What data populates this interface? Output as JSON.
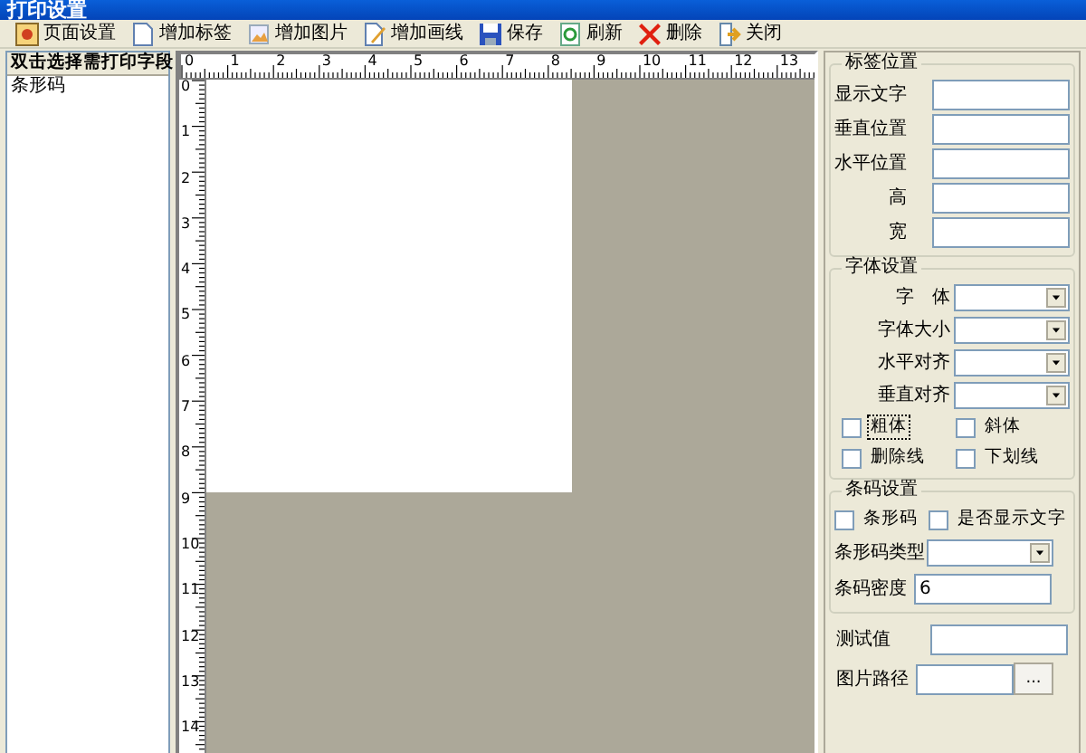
{
  "window": {
    "title": "打印设置"
  },
  "toolbar": [
    {
      "kind": "page",
      "label": "页面设置"
    },
    {
      "kind": "doc",
      "label": "增加标签"
    },
    {
      "kind": "image",
      "label": "增加图片"
    },
    {
      "kind": "pen",
      "label": "增加画线"
    },
    {
      "kind": "save",
      "label": "保存"
    },
    {
      "kind": "refresh",
      "label": "刷新"
    },
    {
      "kind": "delete",
      "label": "删除"
    },
    {
      "kind": "close",
      "label": "关闭"
    }
  ],
  "field_list": {
    "header": "双击选择需打印字段",
    "items": [
      {
        "label": "条形码",
        "selected": false
      }
    ]
  },
  "ruler": {
    "horizontal": [
      "0",
      "1",
      "2",
      "3",
      "4",
      "5",
      "6",
      "7",
      "8",
      "9",
      "10",
      "11",
      "12",
      "13"
    ],
    "vertical": [
      "0",
      "1",
      "2",
      "3",
      "4",
      "5",
      "6",
      "7",
      "8",
      "9",
      "10",
      "11",
      "12",
      "13",
      "14"
    ]
  },
  "label_position": {
    "title": "标签位置",
    "fields": [
      {
        "label": "显示文字"
      },
      {
        "label": "垂直位置"
      },
      {
        "label": "水平位置"
      },
      {
        "label": "高"
      },
      {
        "label": "宽"
      }
    ]
  },
  "font_settings": {
    "title": "字体设置",
    "selects": [
      {
        "label": "字　体"
      },
      {
        "label": "字体大小"
      },
      {
        "label": "水平对齐"
      },
      {
        "label": "垂直对齐"
      }
    ],
    "checkboxes": [
      {
        "label": "粗体",
        "checked": false,
        "focused": true
      },
      {
        "label": "斜体",
        "checked": false,
        "focused": false
      },
      {
        "label": "删除线",
        "checked": false,
        "focused": false
      },
      {
        "label": "下划线",
        "checked": false,
        "focused": false
      }
    ]
  },
  "barcode_settings": {
    "title": "条码设置",
    "checkboxes": [
      {
        "label": "条形码",
        "checked": false
      },
      {
        "label": "是否显示文字",
        "checked": false
      }
    ],
    "type_label": "条形码类型",
    "density_label": "条码密度",
    "density_value": "6"
  },
  "test_value": {
    "label": "测试值"
  },
  "image_path": {
    "label": "图片路径",
    "browse": "..."
  }
}
